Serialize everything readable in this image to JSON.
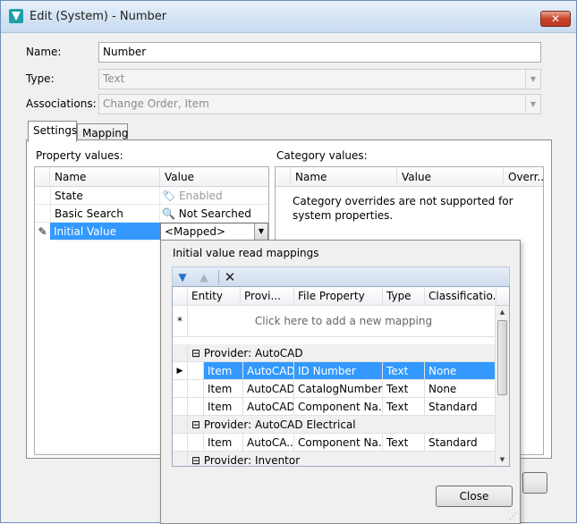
{
  "window": {
    "title": "Edit (System) - Number",
    "close_glyph": "✕"
  },
  "form": {
    "name_label": "Name:",
    "name_value": "Number",
    "type_label": "Type:",
    "type_value": "Text",
    "assoc_label": "Associations:",
    "assoc_value": "Change Order, Item"
  },
  "tabs": [
    {
      "label": "Settings"
    },
    {
      "label": "Mapping"
    }
  ],
  "property_values": {
    "title": "Property values:",
    "columns": [
      "Name",
      "Value"
    ],
    "rows": [
      {
        "name": "State",
        "value": "Enabled",
        "icon": "tag-icon"
      },
      {
        "name": "Basic Search",
        "value": "Not Searched",
        "icon": "search-disabled-icon"
      },
      {
        "name": "Initial Value",
        "value": "<Mapped>",
        "icon": "pencil-icon"
      }
    ]
  },
  "category_values": {
    "title": "Category values:",
    "columns": [
      "Name",
      "Value",
      "Overr..."
    ],
    "message": "Category overrides are not supported for system properties."
  },
  "popup": {
    "title": "Initial value read mappings",
    "columns": [
      "Entity",
      "Provi...",
      "File Property",
      "Type",
      "Classificatio..."
    ],
    "add_hint": "Click here to add a new mapping",
    "groups": [
      {
        "label": "Provider: AutoCAD",
        "rows": [
          [
            "Item",
            "AutoCAD",
            "ID Number",
            "Text",
            "None"
          ],
          [
            "Item",
            "AutoCAD",
            "CatalogNumber",
            "Text",
            "None"
          ],
          [
            "Item",
            "AutoCAD",
            "Component Na...",
            "Text",
            "Standard"
          ]
        ]
      },
      {
        "label": "Provider: AutoCAD Electrical",
        "rows": [
          [
            "Item",
            "AutoCA...",
            "Component Na...",
            "Text",
            "Standard"
          ]
        ]
      },
      {
        "label": "Provider: Inventor",
        "rows": []
      }
    ],
    "close_label": "Close"
  },
  "colors": {
    "selection": "#3399ff",
    "window_bg": "#f0f0f0"
  }
}
